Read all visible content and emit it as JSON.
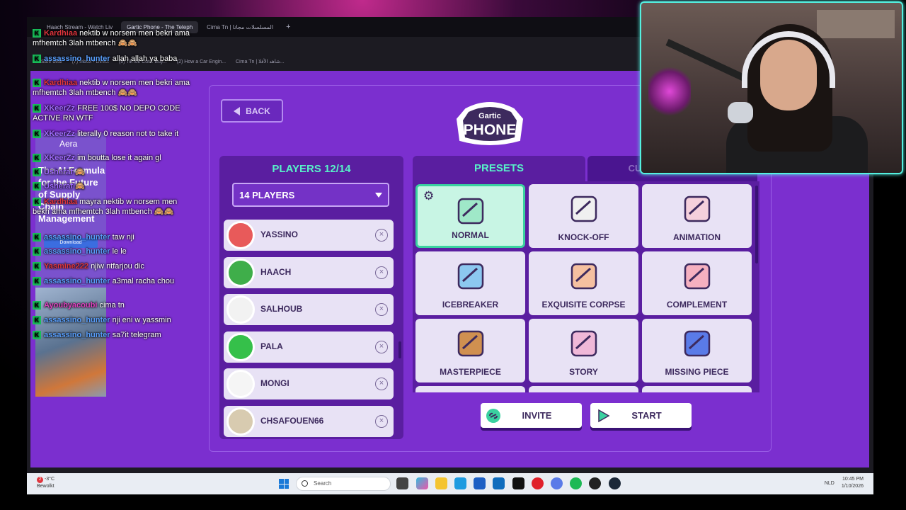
{
  "browser": {
    "tabs": [
      {
        "label": "Haach Stream - Watch Liv",
        "active": false
      },
      {
        "label": "Gartic Phone - The Teleph",
        "active": true
      },
      {
        "label": "Cima Tn | المسلسلات مجانا",
        "active": false
      }
    ],
    "bookmarks": [
      "Safe deal",
      "(7) Inbox • Direct",
      "(9) TikTok Cuts: Buy...",
      "(2) How a Car Engin...",
      "Cima Tn | شاهد الأفلا..."
    ]
  },
  "game": {
    "back_label": "BACK",
    "logo_top": "Gartic",
    "logo_bottom": "PHONE",
    "players_title": "PLAYERS 12/14",
    "players_select": "14 PLAYERS",
    "players": [
      {
        "name": "YASSINO",
        "color": "#e85a5a"
      },
      {
        "name": "HAACH",
        "color": "#3fae4a"
      },
      {
        "name": "SALHOUB",
        "color": "#f2f2f2"
      },
      {
        "name": "PALA",
        "color": "#35c04a"
      },
      {
        "name": "MONGI",
        "color": "#f5f5f5"
      },
      {
        "name": "CHSAFOUEN66",
        "color": "#d8cbb0"
      }
    ],
    "presets_tab": "PRESETS",
    "custom_tab": "CUSTOM SETTINGS",
    "presets": [
      {
        "label": "NORMAL",
        "icon": "pencil-note-icon",
        "selected": true
      },
      {
        "label": "KNOCK-OFF",
        "icon": "cards-icon",
        "selected": false
      },
      {
        "label": "ANIMATION",
        "icon": "animation-icon",
        "selected": false
      },
      {
        "label": "ICEBREAKER",
        "icon": "icebreaker-icon",
        "selected": false
      },
      {
        "label": "EXQUISITE CORPSE",
        "icon": "corpse-icon",
        "selected": false
      },
      {
        "label": "COMPLEMENT",
        "icon": "complement-icon",
        "selected": false
      },
      {
        "label": "MASTERPIECE",
        "icon": "masterpiece-icon",
        "selected": false
      },
      {
        "label": "STORY",
        "icon": "story-icon",
        "selected": false
      },
      {
        "label": "MISSING PIECE",
        "icon": "missing-piece-icon",
        "selected": false
      }
    ],
    "invite_label": "INVITE",
    "start_label": "START"
  },
  "chat": {
    "lines": [
      {
        "user": "Kardhiaa",
        "user_color": "#e0353d",
        "msg": "nektib w norsem men bekri ama mfhemtch 3lah mtbench 🙈🙈"
      },
      {
        "user": "assassino_hunter",
        "user_color": "#5aa0ff",
        "msg": "allah allah ya baba"
      },
      {
        "user": "Kardhiaa",
        "user_color": "#e0353d",
        "msg": "nektib w norsem men bekri ama mfhemtch 3lah mtbench 🙈🙈"
      },
      {
        "user": "XKeerZz",
        "user_color": "#a06aff",
        "msg": "FREE 100$ NO DEPO CODE ACTIVE RN WTF"
      },
      {
        "user": "XKeerZz",
        "user_color": "#a06aff",
        "msg": "literally 0 reason not to take it"
      },
      {
        "user": "XKeerZz",
        "user_color": "#a06aff",
        "msg": "im boutta lose it again gl"
      },
      {
        "user": "Usheraf",
        "user_color": "#a06aff",
        "msg": "🙈"
      },
      {
        "user": "Usheraf",
        "user_color": "#a06aff",
        "msg": "🙈"
      },
      {
        "user": "Kardhiaa",
        "user_color": "#e0353d",
        "msg": "mayra nektib w norsem men bekri ama mfhemtch 3lah mtbench 🙈🙈"
      },
      {
        "user": "assassino_hunter",
        "user_color": "#5aa0ff",
        "msg": "taw nji"
      },
      {
        "user": "assassino_hunter",
        "user_color": "#5aa0ff",
        "msg": "le le"
      },
      {
        "user": "Yasmine222",
        "user_color": "#e0353d",
        "msg": "njiw ntfarjou dic"
      },
      {
        "user": "assassino_hunter",
        "user_color": "#5aa0ff",
        "msg": "a3mal racha chou"
      },
      {
        "user": "Ayoubyacoubi",
        "user_color": "#e040c0",
        "msg": "cima tn"
      },
      {
        "user": "assassino_hunter",
        "user_color": "#5aa0ff",
        "msg": "nji eni w yassmin"
      },
      {
        "user": "assassino_hunter",
        "user_color": "#5aa0ff",
        "msg": "sa7it telegram"
      }
    ]
  },
  "ad": {
    "brand": "Aera",
    "headline": "The AI Formula for the Future of Supply Chain Management",
    "download": "Download"
  },
  "taskbar": {
    "temperature": "-3°C",
    "weather": "Bewolkt",
    "notification_count": "2",
    "search_placeholder": "Search",
    "language": "NLD",
    "time": "10:45 PM",
    "date": "1/10/2026"
  }
}
